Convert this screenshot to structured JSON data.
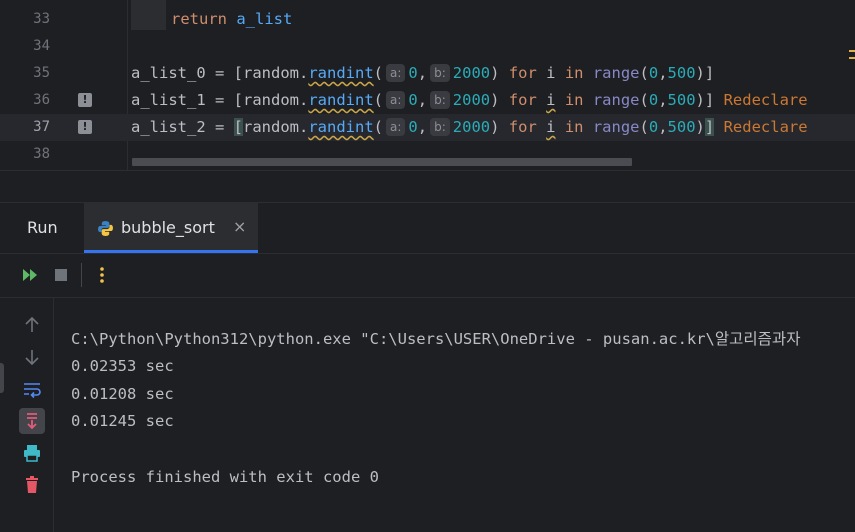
{
  "editor": {
    "lines": [
      {
        "num": "33",
        "code": "return a_list"
      },
      {
        "num": "34",
        "code": ""
      },
      {
        "num": "35",
        "var": "a_list_0",
        "eq": " = ",
        "open": "[",
        "mod": "random",
        "dot": ".",
        "func": "randint",
        "paren": "(",
        "hint_a": "a:",
        "arg_a": "0",
        "comma": ",",
        "hint_b": "b:",
        "arg_b": "2000",
        "close_paren": ")",
        "for": "for",
        "i": "i",
        "in": "in",
        "range": "range",
        "range_args_open": "(",
        "r0": "0",
        "rc": ",",
        "r1": "500",
        "range_close": ")",
        "close": "]",
        "tail": ""
      },
      {
        "num": "36",
        "var": "a_list_1",
        "eq": " = ",
        "open": "[",
        "mod": "random",
        "dot": ".",
        "func": "randint",
        "paren": "(",
        "hint_a": "a:",
        "arg_a": "0",
        "comma": ",",
        "hint_b": "b:",
        "arg_b": "2000",
        "close_paren": ")",
        "for": "for",
        "i": "i",
        "in": "in",
        "range": "range",
        "range_args_open": "(",
        "r0": "0",
        "rc": ",",
        "r1": "500",
        "range_close": ")",
        "close": "]",
        "tail": "Redeclare"
      },
      {
        "num": "37",
        "var": "a_list_2",
        "eq": " = ",
        "open": "[",
        "mod": "random",
        "dot": ".",
        "func": "randint",
        "paren": "(",
        "hint_a": "a:",
        "arg_a": "0",
        "comma": ",",
        "hint_b": "b:",
        "arg_b": "2000",
        "close_paren": ")",
        "for": "for",
        "i": "i",
        "in": "in",
        "range": "range",
        "range_args_open": "(",
        "r0": "0",
        "rc": ",",
        "r1": "500",
        "range_close": ")",
        "close": "]",
        "tail": "Redeclare"
      },
      {
        "num": "38",
        "code": ""
      }
    ],
    "return_kw": "return",
    "return_var": "a_list",
    "warning_icon_glyph": "!"
  },
  "run_panel": {
    "title": "Run",
    "tab_label": "bubble_sort",
    "tab_close": "×",
    "toolbar_icons": [
      "rerun-icon",
      "stop-icon",
      "more-options-icon"
    ],
    "side_icons": [
      "scroll-up-icon",
      "scroll-down-icon",
      "soft-wrap-icon",
      "scroll-to-end-icon",
      "print-icon",
      "clear-all-icon"
    ],
    "console": {
      "command": "C:\\Python\\Python312\\python.exe \"C:\\Users\\USER\\OneDrive - pusan.ac.kr\\알고리즘과자",
      "out1": "0.02353 sec",
      "out2": "0.01208 sec",
      "out3": "0.01245 sec",
      "blank": "",
      "finished": "Process finished with exit code 0"
    }
  },
  "colors": {
    "accent": "#3574f0",
    "keyword": "#cf8e6d",
    "number": "#2aacb8",
    "warning": "#cc7832"
  }
}
